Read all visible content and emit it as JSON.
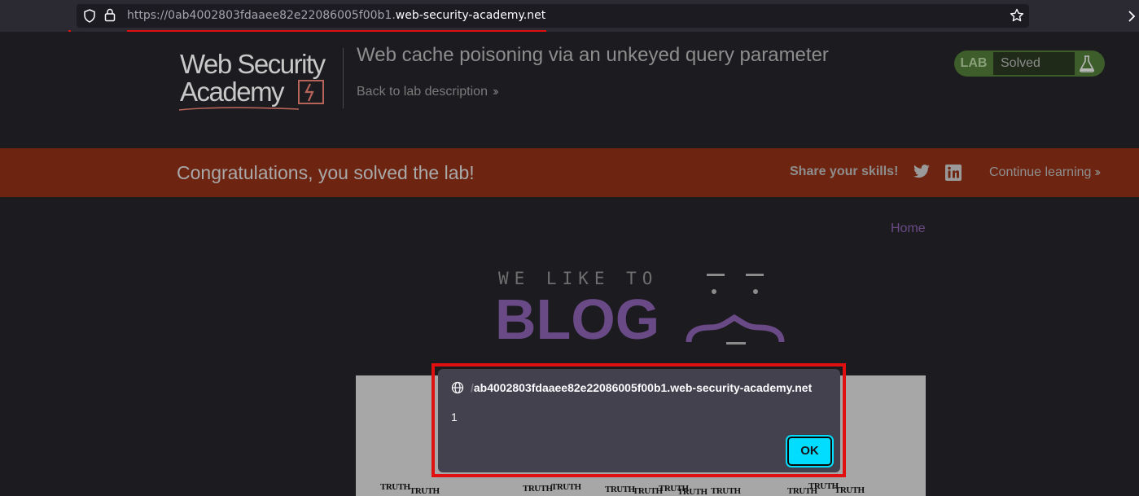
{
  "browser": {
    "url_prefix": "https://0ab4002803fdaaee82e22086005f00b1.",
    "url_domain": "web-security-academy.net"
  },
  "header": {
    "logo_line1": "Web Security",
    "logo_line2": "Academy",
    "lab_title": "Web cache poisoning via an unkeyed query parameter",
    "back_link": "Back to lab description",
    "lab_badge": "LAB",
    "lab_status": "Solved"
  },
  "banner": {
    "congrats": "Congratulations, you solved the lab!",
    "share_label": "Share your skills!",
    "continue_label": "Continue learning"
  },
  "blog": {
    "home_link": "Home",
    "tagline": "WE LIKE TO",
    "title": "BLOG",
    "image_words": [
      "TRUTH",
      "TRUTH",
      "TRUTH",
      "TRUTH",
      "TRUTH",
      "TRUTH",
      "TRUTH",
      "TRUTH",
      "TRUTH",
      "TRUTH",
      "TRUTH",
      "TRUTH"
    ]
  },
  "dialog": {
    "origin_faded": "/",
    "origin": "ab4002803fdaaee82e22086005f00b1.web-security-academy.net",
    "message": "1",
    "ok_label": "OK"
  },
  "colors": {
    "banner": "#6d2511",
    "accent_purple": "#6a4a86",
    "ok_button": "#00ddff",
    "highlight_red": "#e01010"
  }
}
